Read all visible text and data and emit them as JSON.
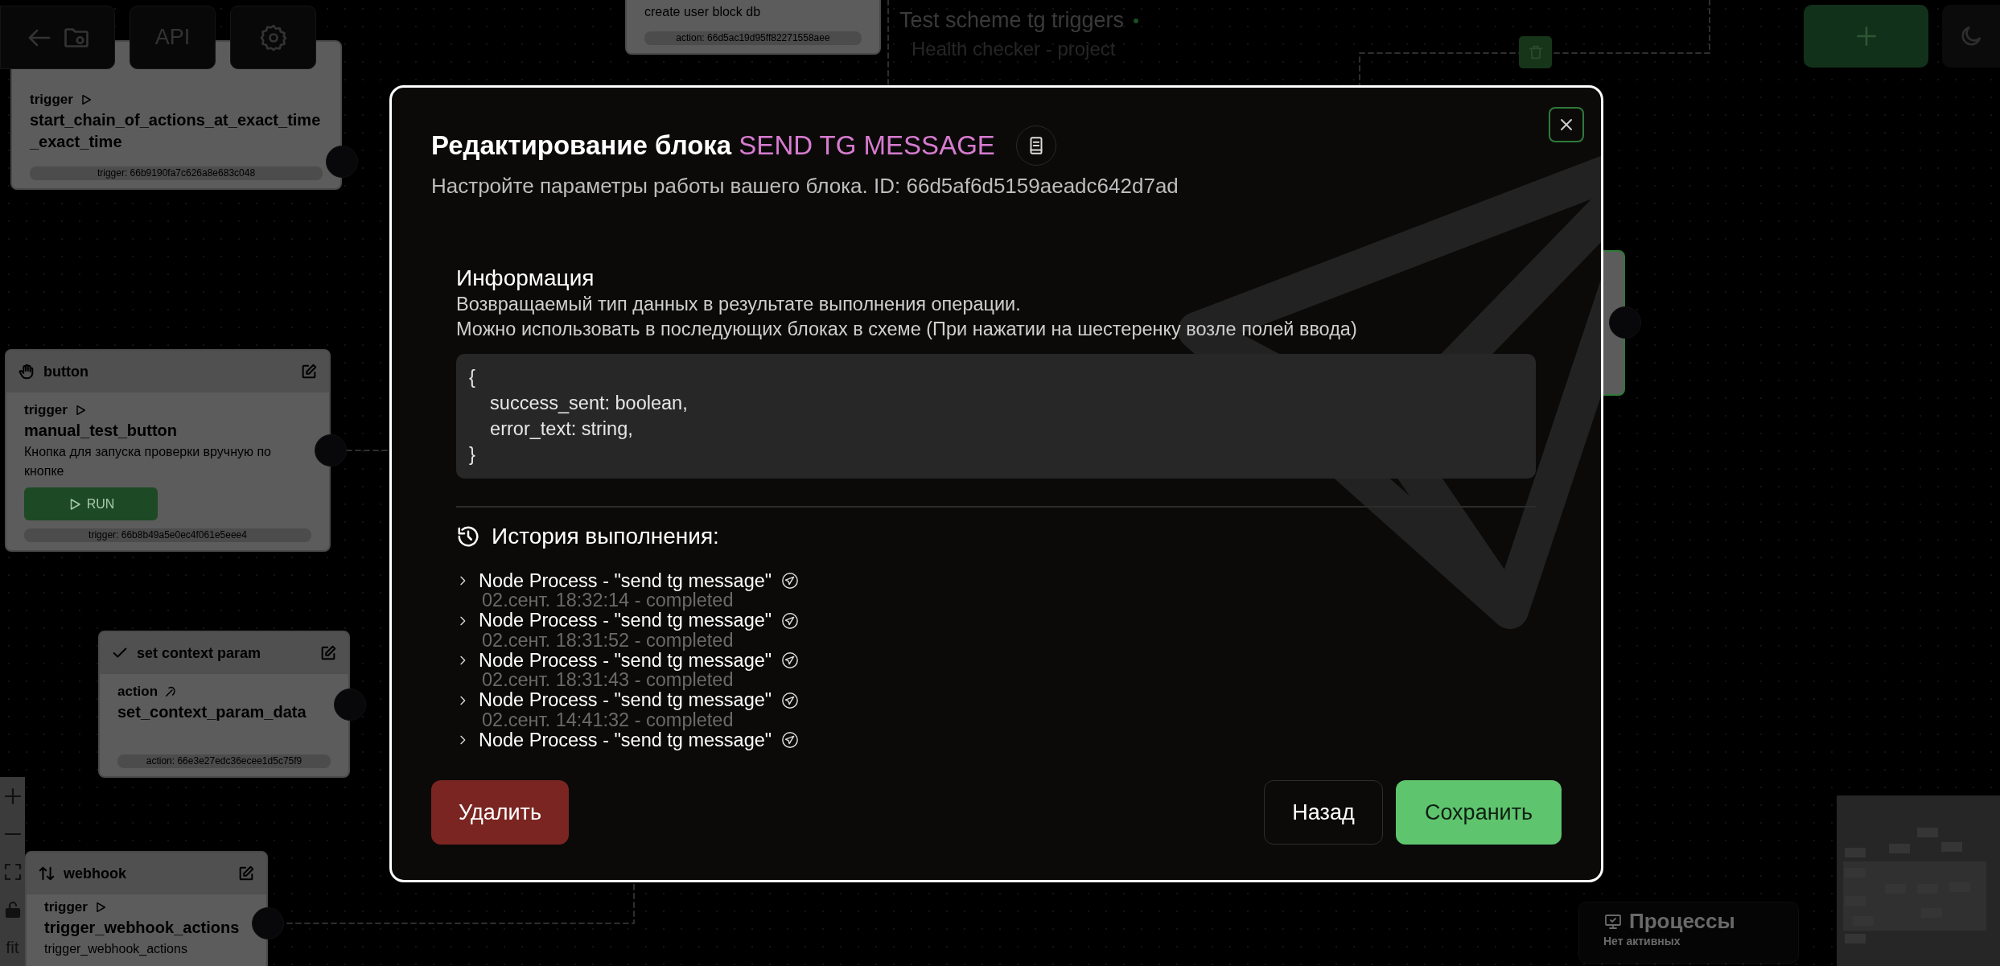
{
  "toolbar": {
    "api_label": "API"
  },
  "scheme": {
    "title": "Test scheme tg triggers",
    "subtitle": "Health checker - project"
  },
  "nodes": [
    {
      "selected": false,
      "type": {
        "label": "trigger",
        "kind": "play"
      },
      "title": "start_chain_of_actions_at_exact_time_exact_time",
      "id_label": "trigger: 66b9190fa7c626a8e683c048"
    },
    {
      "selected": false,
      "description": "create user block db",
      "id_label": "action: 66d5ac19d95ff82271558aee"
    },
    {
      "selected": false,
      "header": {
        "label": "button",
        "kind": "hand"
      },
      "type": {
        "label": "trigger",
        "kind": "play"
      },
      "title": "manual_test_button",
      "description": "Кнопка для запуска проверки вручную по кнопке",
      "run_label": "RUN",
      "id_label": "trigger: 66b8b49a5e0ec4f061e5eee4"
    },
    {
      "selected": false,
      "header": {
        "label": "set context param",
        "kind": "check"
      },
      "type": {
        "label": "action",
        "kind": "pick"
      },
      "title": "set_context_param_data",
      "id_label": "action: 66e3e27edc36ecee1d5c75f9"
    },
    {
      "selected": false,
      "header": {
        "label": "webhook",
        "kind": "arrows"
      },
      "type": {
        "label": "trigger",
        "kind": "play"
      },
      "title": "trigger_webhook_actions",
      "description": "trigger_webhook_actions"
    },
    {
      "selected": true
    }
  ],
  "zoom_controls": {
    "fit_label": "fit"
  },
  "processes": {
    "title": "Процессы",
    "status": "Нет активных"
  },
  "modal": {
    "title": "Редактирование блока",
    "block_name": "SEND TG MESSAGE",
    "subtitle": "Настройте параметры работы вашего блока. ID: 66d5af6d5159aeadc642d7ad",
    "info_heading": "Информация",
    "info_lines": [
      "Возвращаемый тип данных в результате выполнения операции.",
      "Можно использовать в последующих блоках в схеме (При нажатии на шестеренку возле полей ввода)"
    ],
    "code_lines": [
      "{",
      "    success_sent: boolean,",
      "    error_text: string,",
      "}"
    ],
    "history_heading": "История выполнения:",
    "history": [
      {
        "expanded": false,
        "title": "Node Process - \"send tg message\"",
        "meta": "02.сент. 18:32:14 - completed"
      },
      {
        "expanded": false,
        "title": "Node Process - \"send tg message\"",
        "meta": "02.сент. 18:31:52 - completed"
      },
      {
        "expanded": false,
        "title": "Node Process - \"send tg message\"",
        "meta": "02.сент. 18:31:43 - completed"
      },
      {
        "expanded": false,
        "title": "Node Process - \"send tg message\"",
        "meta": "02.сент. 14:41:32 - completed"
      },
      {
        "expanded": false,
        "title": "Node Process - \"send tg message\""
      }
    ],
    "buttons": {
      "delete": "Удалить",
      "back": "Назад",
      "save": "Сохранить"
    }
  }
}
